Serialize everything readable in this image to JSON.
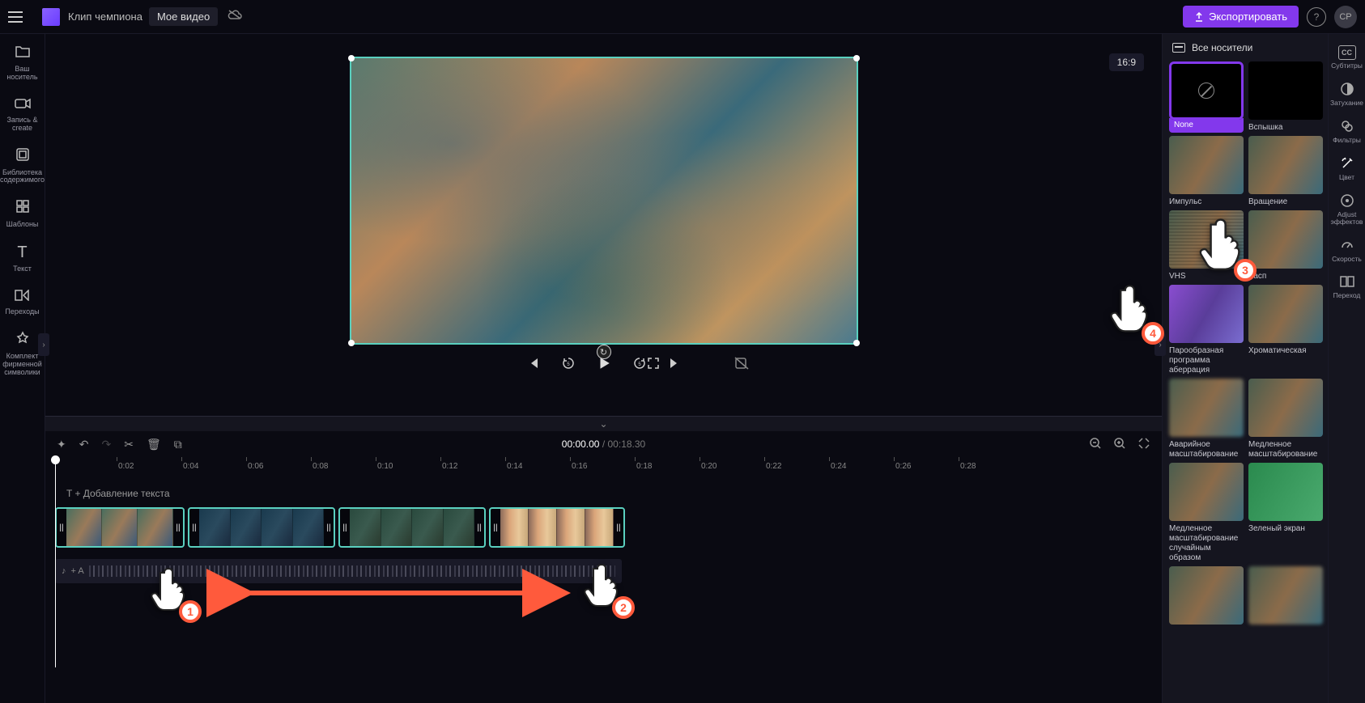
{
  "topbar": {
    "app_title": "Клип чемпиона",
    "project_name": "Мое видео",
    "export_label": "Экспортировать",
    "avatar_initials": "CP"
  },
  "left_sidebar": [
    {
      "icon": "folder",
      "label": "Ваш носитель"
    },
    {
      "icon": "record",
      "label": "Запись &amp; create"
    },
    {
      "icon": "library",
      "label": "Библиотека содержимого"
    },
    {
      "icon": "templates",
      "label": "Шаблоны"
    },
    {
      "icon": "text",
      "label": "Текст"
    },
    {
      "icon": "transitions",
      "label": "Переходы"
    },
    {
      "icon": "brand",
      "label": "Комплект фирменной символики"
    }
  ],
  "right_sidebar": [
    {
      "icon": "cc",
      "label": "Субтитры"
    },
    {
      "icon": "fade",
      "label": "Затухание"
    },
    {
      "icon": "filters",
      "label": "Фильтры"
    },
    {
      "icon": "color",
      "label": "Цвет",
      "active": true
    },
    {
      "icon": "adjust",
      "label": "Adjust эффектов"
    },
    {
      "icon": "speed",
      "label": "Скорость"
    },
    {
      "icon": "transition",
      "label": "Переход"
    }
  ],
  "effects": {
    "header": "Все носители",
    "items": [
      {
        "name": "None",
        "thumb": "none",
        "selected": true
      },
      {
        "name": "Вспышка",
        "thumb": "dark"
      },
      {
        "name": "Импульс",
        "thumb": "tex"
      },
      {
        "name": "Вращение",
        "thumb": "tex"
      },
      {
        "name": "VHS",
        "thumb": "vhs"
      },
      {
        "name": "Расп",
        "thumb": "tex"
      },
      {
        "name": "Парообразная программа аберрация",
        "thumb": "aberr"
      },
      {
        "name": "Хроматическая",
        "thumb": "tex"
      },
      {
        "name": "Аварийное масштабирование",
        "thumb": "blur"
      },
      {
        "name": "Медленное масштабирование",
        "thumb": "tex"
      },
      {
        "name": "Медленное масштабирование случайным образом",
        "thumb": "tex"
      },
      {
        "name": "Зеленый экран",
        "thumb": "green"
      },
      {
        "name": "",
        "thumb": "tex"
      },
      {
        "name": "",
        "thumb": "blur"
      }
    ]
  },
  "preview": {
    "aspect": "16:9"
  },
  "timeline": {
    "current": "00:00.00",
    "duration": "00:18.30",
    "text_prompt": "T + Добавление текста",
    "audio_prompt": "+ A",
    "ticks": [
      "0:02",
      "0:04",
      "0:06",
      "0:08",
      "0:10",
      "0:12",
      "0:14",
      "0:16",
      "0:18",
      "0:20",
      "0:22",
      "0:24",
      "0:26",
      "0:28"
    ]
  },
  "pointers": {
    "p1": "1",
    "p2": "2",
    "p3": "3",
    "p4": "4"
  }
}
